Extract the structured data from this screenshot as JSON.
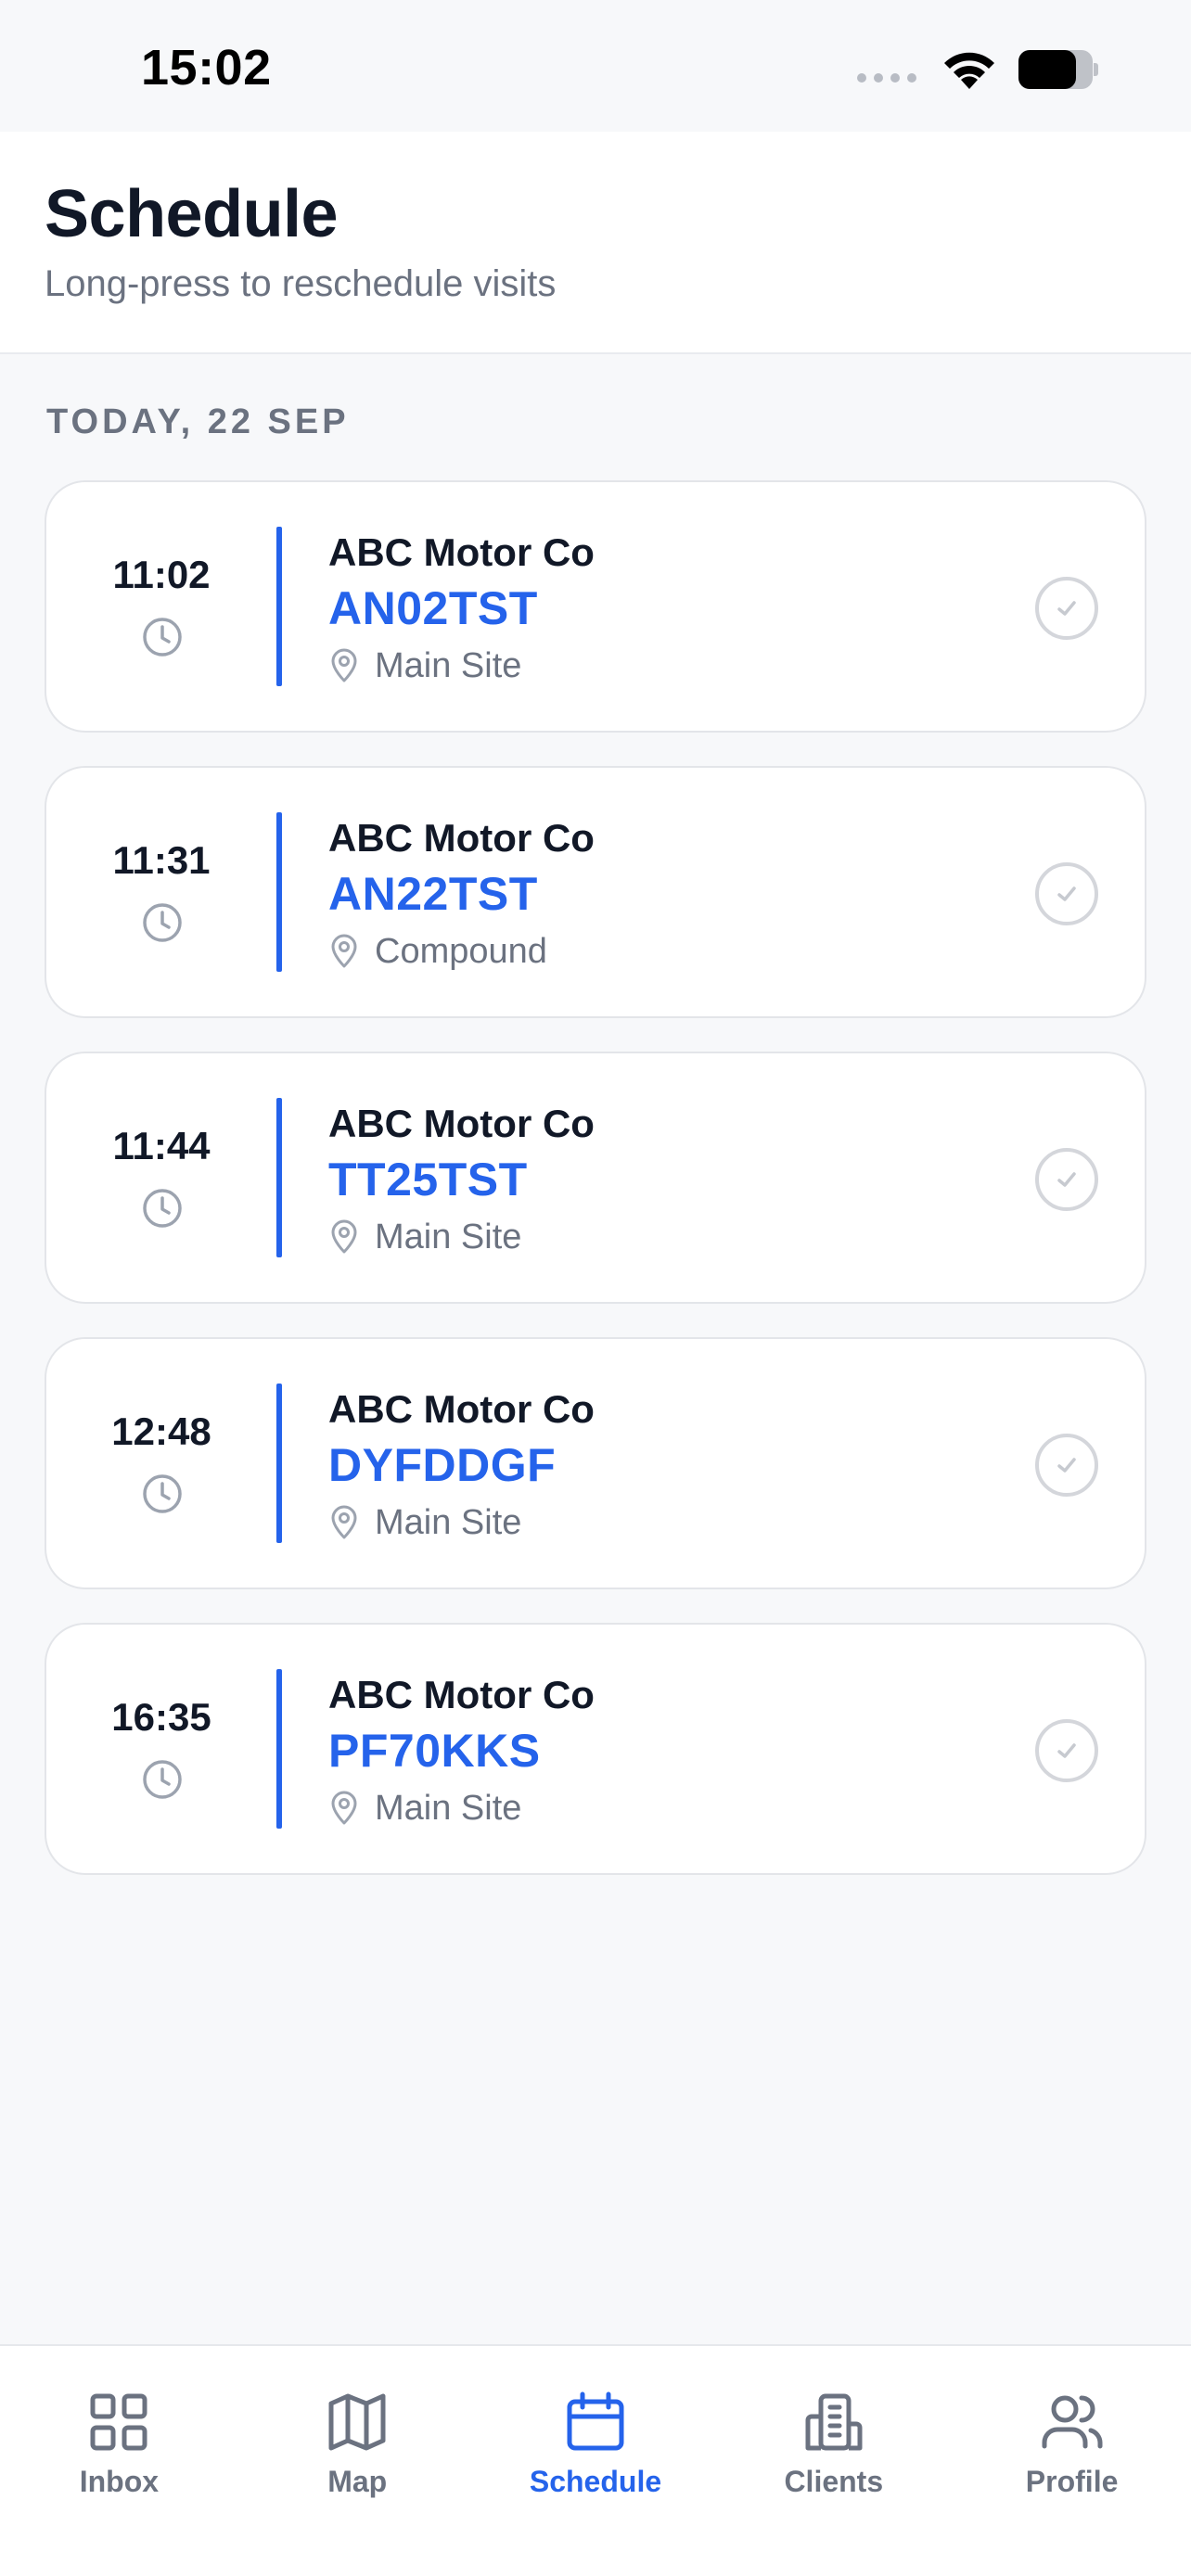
{
  "status_bar": {
    "time": "15:02",
    "battery_level": 0.78
  },
  "header": {
    "title": "Schedule",
    "subtitle": "Long-press to reschedule visits"
  },
  "section": {
    "label": "TODAY, 22 SEP"
  },
  "visits": [
    {
      "time": "11:02",
      "client": "ABC Motor Co",
      "registration": "AN02TST",
      "location": "Main Site"
    },
    {
      "time": "11:31",
      "client": "ABC Motor Co",
      "registration": "AN22TST",
      "location": "Compound"
    },
    {
      "time": "11:44",
      "client": "ABC Motor Co",
      "registration": "TT25TST",
      "location": "Main Site"
    },
    {
      "time": "12:48",
      "client": "ABC Motor Co",
      "registration": "DYFDDGF",
      "location": "Main Site"
    },
    {
      "time": "16:35",
      "client": "ABC Motor Co",
      "registration": "PF70KKS",
      "location": "Main Site"
    }
  ],
  "tab_bar": {
    "tabs": [
      {
        "label": "Inbox",
        "icon": "grid-icon",
        "active": false
      },
      {
        "label": "Map",
        "icon": "map-icon",
        "active": false
      },
      {
        "label": "Schedule",
        "icon": "calendar-icon",
        "active": true
      },
      {
        "label": "Clients",
        "icon": "building-icon",
        "active": false
      },
      {
        "label": "Profile",
        "icon": "users-icon",
        "active": false
      }
    ]
  },
  "colors": {
    "accent": "#2563eb",
    "text_primary": "#111827",
    "text_secondary": "#6b7280",
    "background": "#f7f8fa"
  }
}
